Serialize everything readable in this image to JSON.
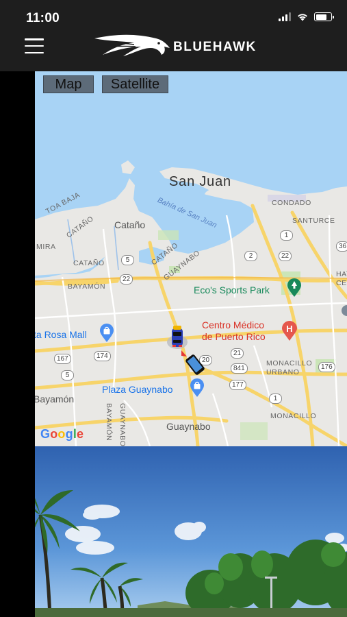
{
  "status_bar": {
    "time": "11:00",
    "battery_level": 0.75,
    "signal_bars_active": 3,
    "signal_bars_total": 4
  },
  "header": {
    "brand": "BLUEHAWK",
    "menu_icon": "hamburger-menu-icon"
  },
  "map": {
    "buttons": {
      "map": "Map",
      "satellite": "Satellite"
    },
    "labels": {
      "san_juan": "San Juan",
      "bay": "Bahía de San Juan",
      "catano_city": "Cataño",
      "toa_baja": "TOA BAJA",
      "catano_small": "CATAÑO",
      "catano_small2": "CATAÑO",
      "catano_small3": "CATAÑO",
      "mira": "MIRA",
      "bayamon_small": "BAYAMÓN",
      "guaynabo_small": "GUAYNABO",
      "guaynabo_vert": "GUAYNABO",
      "bayamon_vert": "BAYAMÓN",
      "condado": "CONDADO",
      "santurce": "SANTURCE",
      "hato": "HATO",
      "cer": "CER",
      "monacillo_urbano": "MONACILLO\nURBANO",
      "monacillo": "MONACILLO",
      "bayamon_city": "Bayamón",
      "guaynabo_city": "Guaynabo",
      "ecos": "Eco's Sports Park",
      "centro_medico": "Centro Médico\nde Puerto Rico",
      "santa_rosa": "ta Rosa Mall",
      "plaza": "Plaza Guaynabo"
    },
    "routes": [
      "1",
      "5",
      "2",
      "22",
      "22",
      "36",
      "20",
      "21",
      "841",
      "177",
      "167",
      "174",
      "5",
      "176",
      "1"
    ],
    "google": [
      "G",
      "o",
      "o",
      "g",
      "l",
      "e"
    ],
    "colors": {
      "water": "#a8d3f5",
      "land": "#e8e8e6",
      "highway": "#f7d46a",
      "green": "#cbe5b8",
      "poi_green": "#17895a",
      "poi_red": "#d93025",
      "poi_blue": "#1a73e8"
    }
  },
  "street_view": {
    "description_icon": "street-view-photo"
  }
}
